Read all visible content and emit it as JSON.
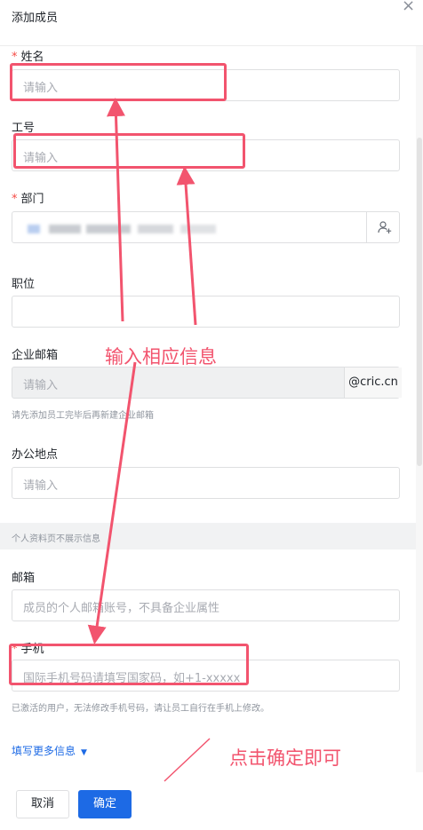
{
  "dialog": {
    "title": "添加成员",
    "close_glyph": "×"
  },
  "form": {
    "required_mark": "*",
    "name": {
      "label": "姓名",
      "placeholder": "请输入"
    },
    "employee_id": {
      "label": "工号",
      "placeholder": "请输入"
    },
    "department": {
      "label": "部门"
    },
    "position": {
      "label": "职位",
      "value": ""
    },
    "corp_email": {
      "label": "企业邮箱",
      "placeholder": "请输入",
      "suffix": "@cric.cn",
      "hint": "请先添加员工完毕后再新建企业邮箱"
    },
    "office": {
      "label": "办公地点",
      "placeholder": "请输入"
    },
    "section_hidden_info": "个人资料页不展示信息",
    "email": {
      "label": "邮箱",
      "placeholder": "成员的个人邮箱账号，不具备企业属性"
    },
    "mobile": {
      "label": "手机",
      "placeholder": "国际手机号码请填写国家码，如+1-xxxxx",
      "hint": "已激活的用户，无法修改手机号码，请让员工自行在手机上修改。"
    },
    "more_info_link": "填写更多信息",
    "more_info_caret": "▼"
  },
  "footer": {
    "cancel_label": "取消",
    "ok_label": "确定"
  },
  "annotations": {
    "input_note": "输入相应信息",
    "confirm_note": "点击确定即可",
    "color": "#f2546e"
  }
}
